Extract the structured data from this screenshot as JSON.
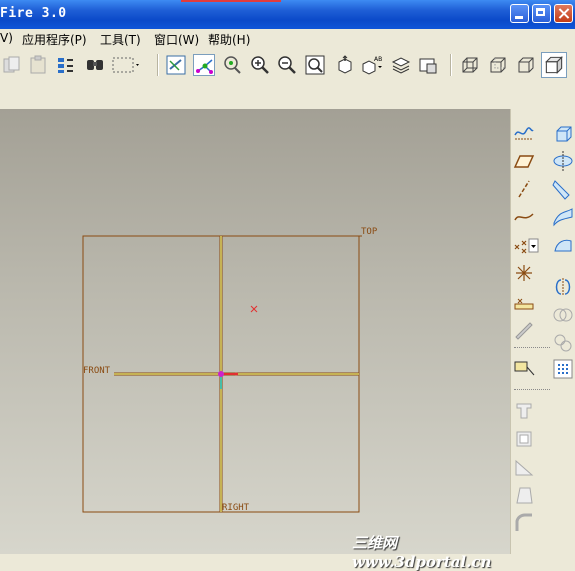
{
  "window": {
    "title": "Fire 3.0"
  },
  "menubar": {
    "items": [
      "V)",
      "应用程序(P)",
      "工具(T)",
      "窗口(W)",
      "帮助(H)"
    ]
  },
  "toolbar": {
    "icons": [
      "copy-icon",
      "paste-icon",
      "paste-special-icon",
      "regenerate-icon",
      "find-icon",
      "select-box-icon",
      "repaint-icon",
      "spin-center-icon",
      "orient-mode-icon",
      "zoom-in-icon",
      "zoom-out-icon",
      "refit-icon",
      "view-manager-icon",
      "named-views-icon",
      "layers-icon",
      "view-manager2-icon",
      "wireframe-icon",
      "hidden-line-icon",
      "no-hidden-icon",
      "shading-icon"
    ],
    "dropdown_label": "AB"
  },
  "canvas": {
    "datum_planes": [
      "TOP",
      "FRONT",
      "RIGHT"
    ],
    "colors": {
      "datum": "#8a4b12",
      "axis": "#d9d56a",
      "csys_x": "#e23030",
      "csys_origin": "#cc22cc",
      "csys_z": "#22cccc"
    }
  },
  "right_panel": {
    "icons": [
      "datum-graph-icon",
      "datum-plane-icon",
      "datum-axis-icon",
      "datum-curve-icon",
      "datum-point-icon",
      "datum-csys-icon",
      "analysis-icon",
      "sketch-icon",
      "note-icon",
      "hole-icon",
      "shell-icon",
      "rib-icon",
      "draft-icon",
      "round-icon",
      "extrude-icon",
      "revolve-icon",
      "sweep-icon",
      "blend-icon",
      "boundary-icon",
      "mirror-icon",
      "merge-icon",
      "trim-icon",
      "pattern-icon"
    ]
  },
  "watermark": "三维网 www.3dportal.cn"
}
